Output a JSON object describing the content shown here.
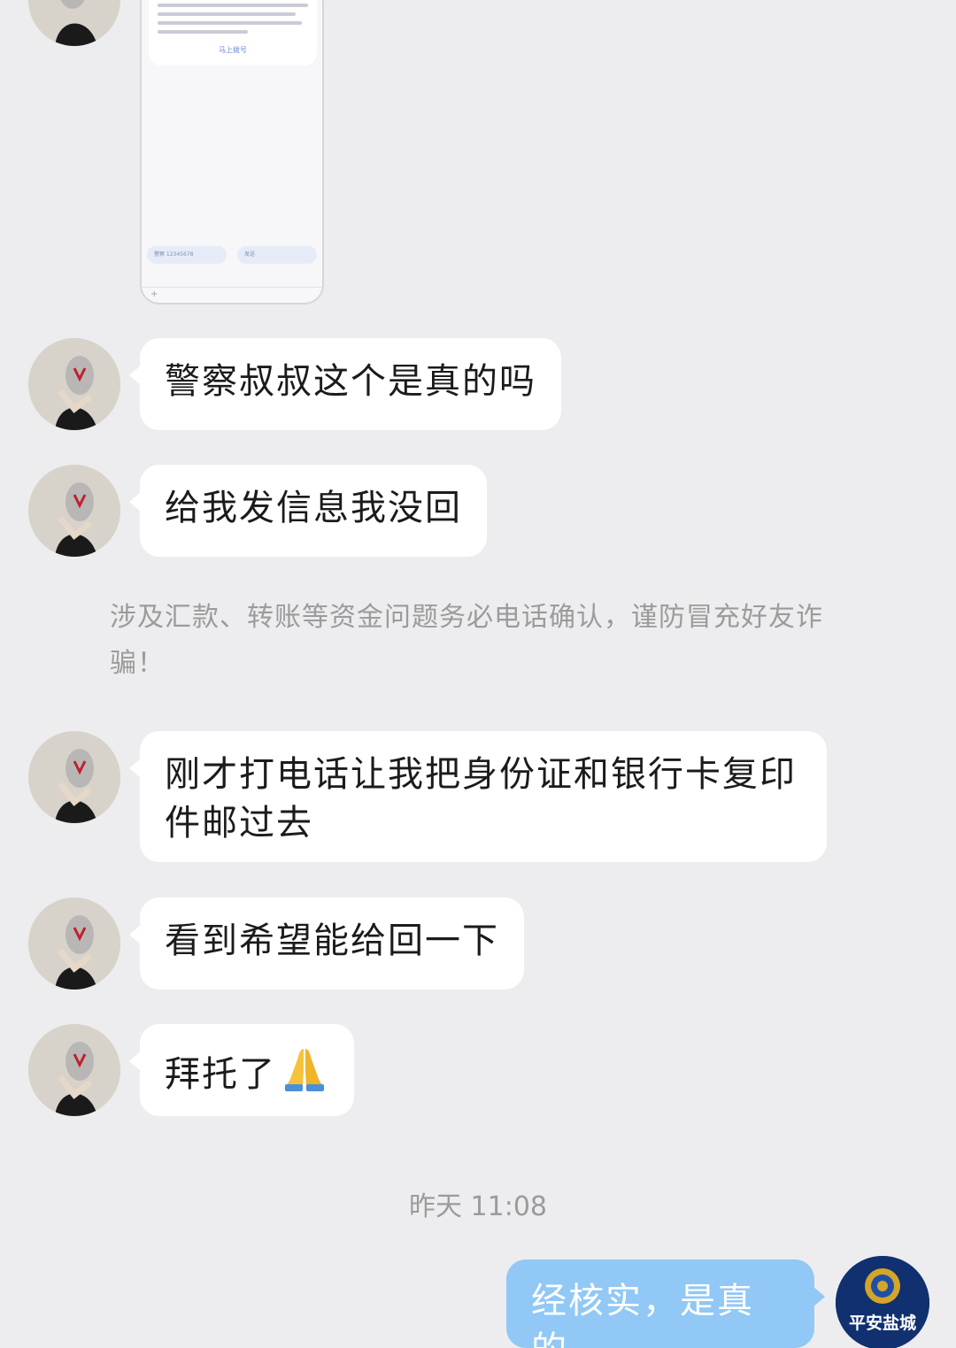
{
  "thumbnail": {
    "link_text": "马上拨号",
    "chip_left": "警察 12345678",
    "chip_right": "发送",
    "input_plus": "+"
  },
  "messages": [
    {
      "text": "警察叔叔这个是真的吗"
    },
    {
      "text": "给我发信息我没回"
    },
    {
      "text": "刚才打电话让我把身份证和银行卡复印件邮过去"
    },
    {
      "text": "看到希望能给回一下"
    },
    {
      "text": "拜托了",
      "emoji": "folded-hands"
    }
  ],
  "system_notice": "涉及汇款、转账等资金问题务必电话确认，谨防冒充好友诈骗！",
  "timestamp": "昨天 11:08",
  "reply": {
    "text": "经核实，是真的"
  },
  "police_avatar": {
    "label": "平安盐城",
    "icon": "police-badge-icon"
  },
  "colors": {
    "background": "#ededef",
    "incoming_bubble": "#ffffff",
    "outgoing_bubble": "#91c8f5",
    "notice_text": "#9b9b9b"
  }
}
